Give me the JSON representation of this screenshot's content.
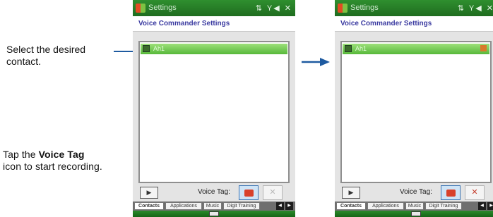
{
  "callouts": {
    "select_contact": "Select the desired contact.",
    "tap_prefix": "Tap the",
    "tap_bold": "Voice Tag",
    "tap_suffix": "icon to start recording."
  },
  "screens": [
    {
      "title": "Settings",
      "status_icons": "⇅ Y◀ ✕",
      "header": "Voice Commander Settings",
      "selected_contact": "Ah1",
      "play_symbol": "▶",
      "voice_tag_label": "Voice Tag:",
      "delete_symbol": "✕",
      "tabs": [
        "Contacts",
        "Applications",
        "Music",
        "Digit Training"
      ],
      "active_tab": "Contacts"
    },
    {
      "title": "Settings",
      "status_icons": "⇅ Y◀ ✕",
      "header": "Voice Commander Settings",
      "selected_contact": "Ah1",
      "play_symbol": "▶",
      "voice_tag_label": "Voice Tag:",
      "delete_symbol": "✕",
      "tabs": [
        "Contacts",
        "Applications",
        "Music",
        "Digit Training"
      ],
      "active_tab": "Contacts"
    }
  ],
  "colors": {
    "accent": "#1e5aa0",
    "titlebar": "#2f8f2f",
    "selection": "#57b83a",
    "header_text": "#3a3aa0"
  },
  "icons": {
    "start": "windows-start-icon",
    "contact": "contact-card-icon",
    "voice_tag": "voice-tag-icon",
    "play": "play-icon",
    "delete": "delete-icon",
    "keyboard": "keyboard-icon",
    "arrow": "arrow-right-icon"
  }
}
